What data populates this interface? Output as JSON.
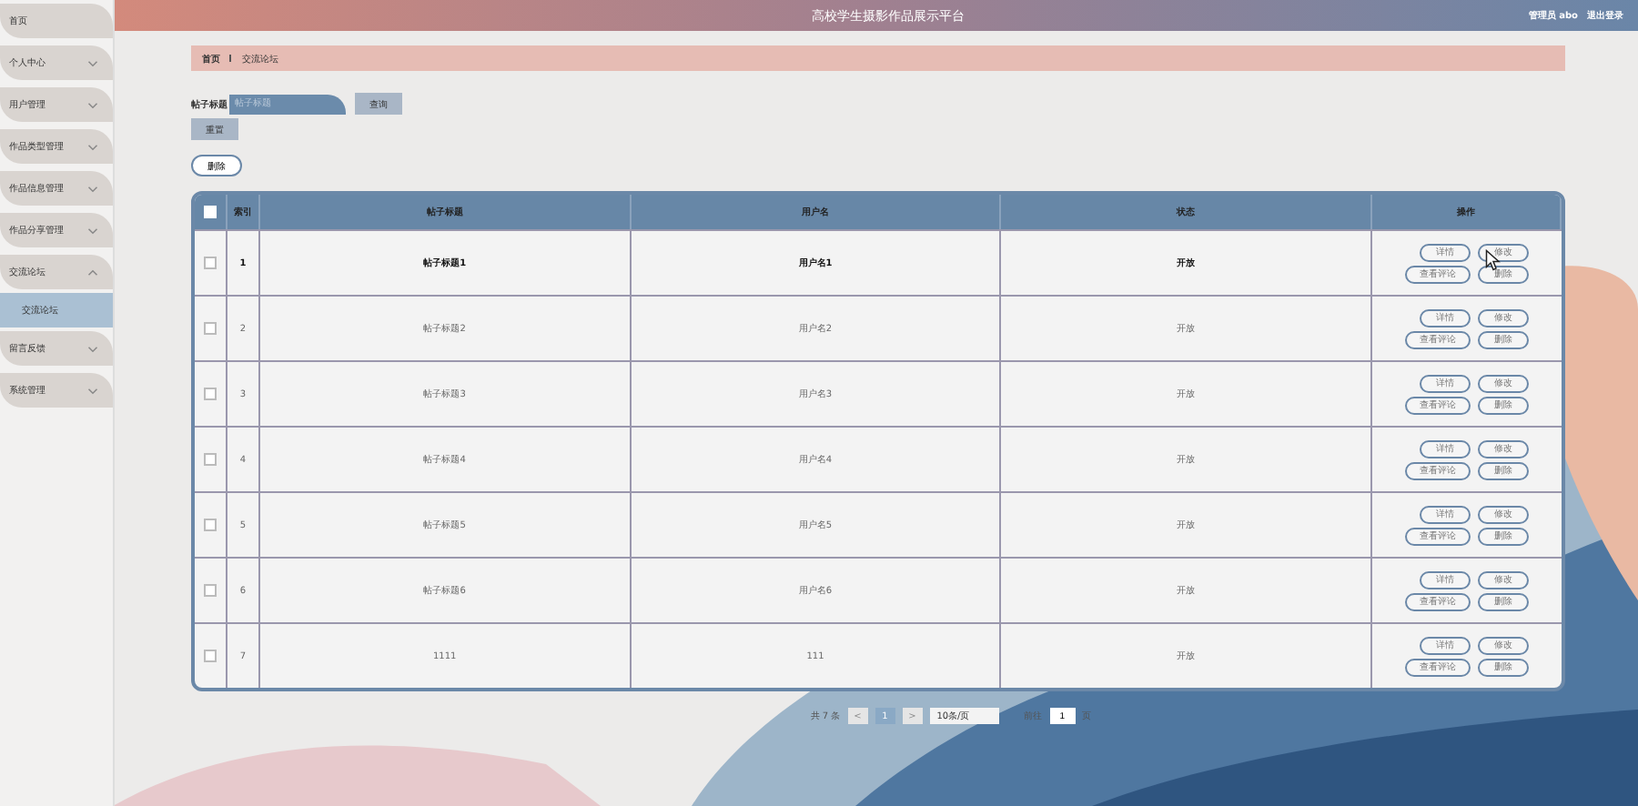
{
  "header": {
    "title": "高校学生摄影作品展示平台",
    "user": "管理员 abo",
    "logout": "退出登录"
  },
  "sidebar": {
    "items": [
      {
        "label": "首页",
        "has_arrow": false
      },
      {
        "label": "个人中心",
        "has_arrow": true,
        "expanded": false
      },
      {
        "label": "用户管理",
        "has_arrow": true,
        "expanded": false
      },
      {
        "label": "作品类型管理",
        "has_arrow": true,
        "expanded": false
      },
      {
        "label": "作品信息管理",
        "has_arrow": true,
        "expanded": false
      },
      {
        "label": "作品分享管理",
        "has_arrow": true,
        "expanded": false
      },
      {
        "label": "交流论坛",
        "has_arrow": true,
        "expanded": true,
        "children": [
          {
            "label": "交流论坛",
            "selected": true
          }
        ]
      },
      {
        "label": "留言反馈",
        "has_arrow": true,
        "expanded": false
      },
      {
        "label": "系统管理",
        "has_arrow": true,
        "expanded": false
      }
    ]
  },
  "breadcrumb": [
    "首页",
    "交流论坛"
  ],
  "search": {
    "label": "帖子标题",
    "placeholder": "帖子标题",
    "button": "查询",
    "reset": "重置"
  },
  "delete_button": "删除",
  "table": {
    "select_all": {
      "checked": false
    },
    "columns": [
      "索引",
      "帖子标题",
      "用户名",
      "状态",
      "操作"
    ],
    "rows": [
      {
        "checked": false,
        "index": "1",
        "title": "帖子标题1",
        "user": "用户名1",
        "status": "开放",
        "hover": true,
        "actions": [
          "详情",
          "修改",
          "查看评论",
          "删除"
        ]
      },
      {
        "checked": false,
        "index": "2",
        "title": "帖子标题2",
        "user": "用户名2",
        "status": "开放",
        "hover": false,
        "actions": [
          "详情",
          "修改",
          "查看评论",
          "删除"
        ]
      },
      {
        "checked": false,
        "index": "3",
        "title": "帖子标题3",
        "user": "用户名3",
        "status": "开放",
        "hover": false,
        "actions": [
          "详情",
          "修改",
          "查看评论",
          "删除"
        ]
      },
      {
        "checked": false,
        "index": "4",
        "title": "帖子标题4",
        "user": "用户名4",
        "status": "开放",
        "hover": false,
        "actions": [
          "详情",
          "修改",
          "查看评论",
          "删除"
        ]
      },
      {
        "checked": false,
        "index": "5",
        "title": "帖子标题5",
        "user": "用户名5",
        "status": "开放",
        "hover": false,
        "actions": [
          "详情",
          "修改",
          "查看评论",
          "删除"
        ]
      },
      {
        "checked": false,
        "index": "6",
        "title": "帖子标题6",
        "user": "用户名6",
        "status": "开放",
        "hover": false,
        "actions": [
          "详情",
          "修改",
          "查看评论",
          "删除"
        ]
      },
      {
        "checked": false,
        "index": "7",
        "title": "1111",
        "user": "111",
        "status": "开放",
        "hover": false,
        "actions": [
          "详情",
          "修改",
          "查看评论",
          "删除"
        ]
      }
    ]
  },
  "pagination": {
    "total": "共 7 条",
    "prev": "<",
    "pages": [
      {
        "label": "1",
        "selected": true
      }
    ],
    "next": ">",
    "page_size": "10条/页",
    "goto": "前往",
    "goto_value": "1",
    "page_unit": "页"
  }
}
